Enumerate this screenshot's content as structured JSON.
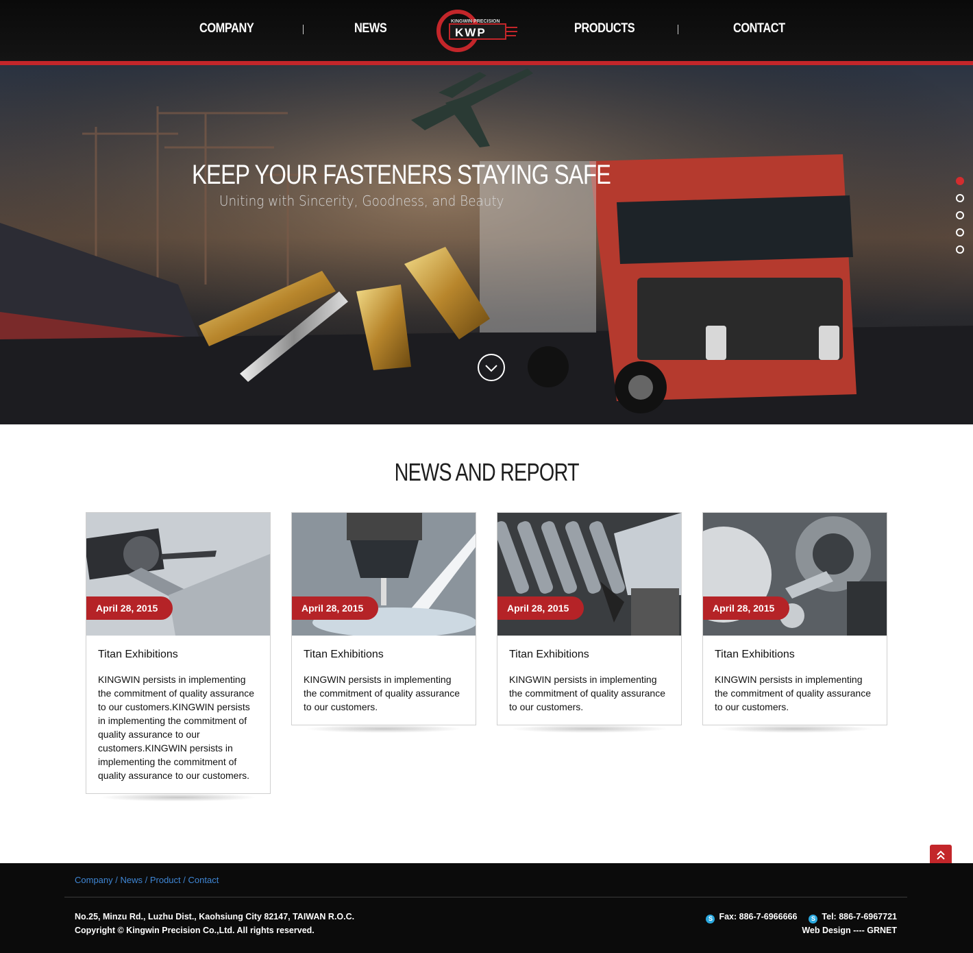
{
  "nav": {
    "company": "COMPANY",
    "news": "NEWS",
    "products": "PRODUCTS",
    "contact": "CONTACT"
  },
  "logo": {
    "text_top": "KINGWIN PRECISION",
    "text_main": "KWP"
  },
  "hero": {
    "title": "KEEP YOUR FASTENERS STAYING SAFE",
    "subtitle": "Uniting with Sincerity, Goodness, and Beauty",
    "slides": 5,
    "active_slide": 1
  },
  "news": {
    "title": "NEWS AND REPORT",
    "cards": [
      {
        "date": "April 28, 2015",
        "title": "Titan Exhibitions",
        "text": "KINGWIN persists in implementing the commitment of quality assurance to our customers.KINGWIN persists in implementing the commitment of quality assurance to our customers.KINGWIN persists in implementing the commitment of quality assurance to our customers."
      },
      {
        "date": "April 28, 2015",
        "title": "Titan Exhibitions",
        "text": "KINGWIN persists in implementing the commitment of quality assurance to our customers."
      },
      {
        "date": "April 28, 2015",
        "title": "Titan Exhibitions",
        "text": "KINGWIN persists in implementing the commitment of quality assurance to our customers."
      },
      {
        "date": "April 28, 2015",
        "title": "Titan Exhibitions",
        "text": "KINGWIN persists in implementing the commitment of quality assurance to our customers."
      }
    ]
  },
  "footer": {
    "links": [
      "Company",
      "News",
      "Product",
      "Contact"
    ],
    "separator": " / ",
    "address": "No.25, Minzu Rd., Luzhu Dist., Kaohsiung City 82147, TAIWAN R.O.C.",
    "copyright": "Copyright © Kingwin Precision Co.,Ltd. All rights reserved.",
    "fax": "Fax: 886-7-6966666",
    "tel": "Tel: 886-7-6967721",
    "web_design_label": "Web Design ---- ",
    "web_design_name": "GRNET"
  },
  "colors": {
    "accent": "#c3262a",
    "link": "#3f86d4",
    "footer_bg": "#0b0b0b"
  },
  "icons": [
    "chevron-down-icon",
    "chevron-double-up-icon",
    "skype-icon"
  ]
}
